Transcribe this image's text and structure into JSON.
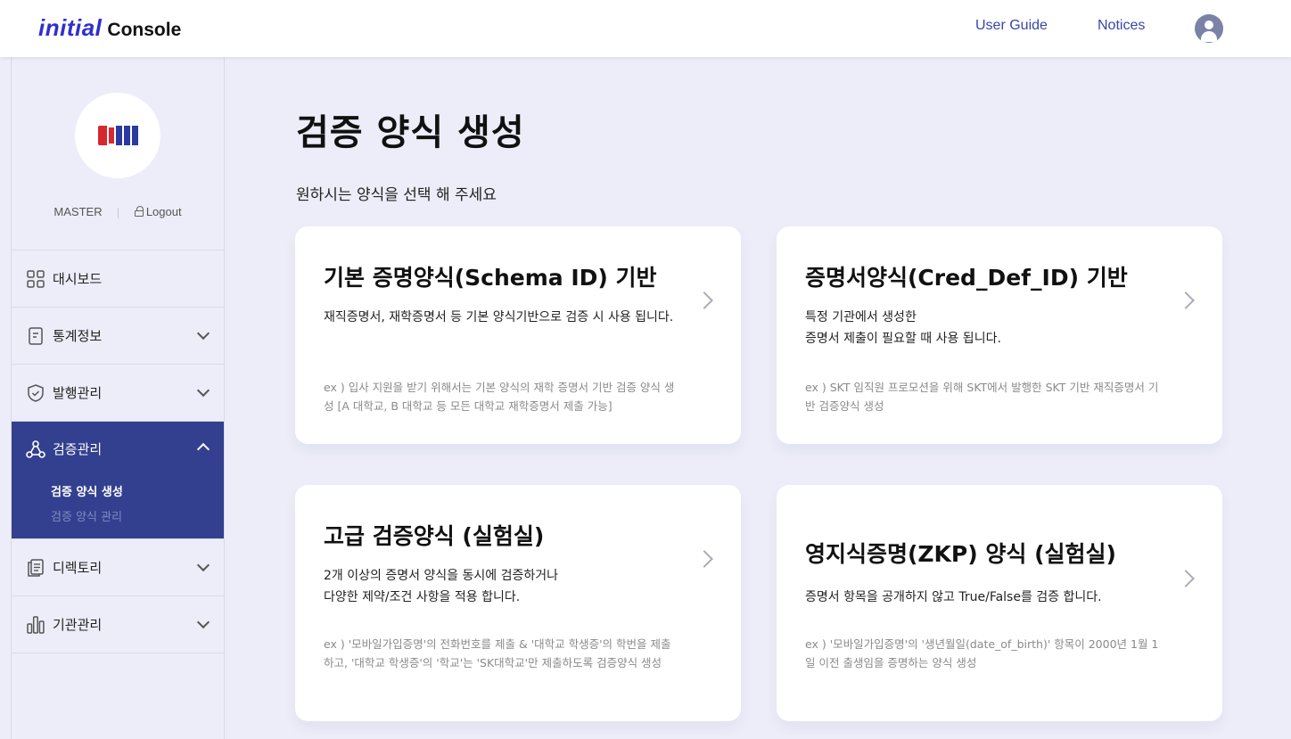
{
  "header": {
    "brand_initial": "initial",
    "brand_console": "Console",
    "user_guide": "User Guide",
    "notices": "Notices",
    "avatar_icon": "user-avatar-icon"
  },
  "sidebar": {
    "org_logo_colors": [
      "#d7282f",
      "#2a3aa0"
    ],
    "user_role": "MASTER",
    "logout": "Logout",
    "items": [
      {
        "label": "대시보드",
        "icon": "dashboard-grid-icon"
      },
      {
        "label": "통계정보",
        "icon": "document-icon"
      },
      {
        "label": "발행관리",
        "icon": "shield-check-icon"
      },
      {
        "label": "검증관리",
        "icon": "network-nodes-icon",
        "active": true,
        "sub": [
          {
            "label": "검증 양식 생성",
            "selected": true
          },
          {
            "label": "검증 양식 관리",
            "selected": false
          }
        ]
      },
      {
        "label": "디렉토리",
        "icon": "directory-icon"
      },
      {
        "label": "기관관리",
        "icon": "bar-chart-icon"
      }
    ],
    "active_color": "#33408f"
  },
  "main": {
    "title": "검증 양식 생성",
    "description": "원하시는 양식을 선택 해 주세요",
    "cards": [
      {
        "title": "기본 증명양식(Schema ID) 기반",
        "body": "재직증명서, 재학증명서 등 기본 양식기반으로 검증 시 사용 됩니다.",
        "example": "ex ) 입사 지원을 받기 위해서는 기본 양식의  재학 증명서 기반 검증 양식 생성 [A 대학교, B 대학교 등 모든 대학교 재학증명서 제출 가능]"
      },
      {
        "title": "증명서양식(Cred_Def_ID) 기반",
        "body": "특정 기관에서 생성한\n증명서 제출이 필요할 때 사용 됩니다.",
        "example": "ex ) SKT 임직원 프로모션을 위해 SKT에서 발행한 SKT 기반 재직증명서 기반 검증양식 생성"
      },
      {
        "title": "고급 검증양식 (실험실)",
        "body": "2개 이상의 증명서 양식을 동시에 검증하거나\n다양한 제약/조건 사항을 적용 합니다.",
        "example": "ex ) '모바일가입증명'의 전화번호를 제출 & '대학교 학생증'의 학번을 제출하고, '대학교 학생증'의 '학교'는 'SK대학교'만 제출하도록 검증양식 생성"
      },
      {
        "title": "영지식증명(ZKP) 양식 (실험실)",
        "body": "증명서 항목을 공개하지 않고 True/False를 검증 합니다.",
        "example": "ex ) '모바일가입증명'의 '생년월일(date_of_birth)' 항목이 2000년 1월 1일 이전 출생임을 증명하는 양식 생성"
      }
    ]
  }
}
